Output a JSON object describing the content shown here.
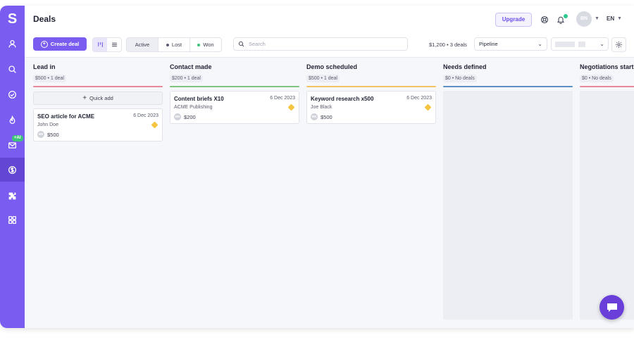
{
  "app": {
    "logo_letter": "S",
    "page_title": "Deals"
  },
  "sidebar": {
    "items": [
      {
        "name": "user-icon"
      },
      {
        "name": "search-icon"
      },
      {
        "name": "check-circle-icon"
      },
      {
        "name": "fire-icon"
      },
      {
        "name": "mail-icon",
        "badge": "+AI"
      },
      {
        "name": "dollar-icon",
        "active": true
      },
      {
        "name": "puzzle-icon"
      },
      {
        "name": "apps-icon"
      }
    ]
  },
  "header": {
    "upgrade_label": "Upgrade",
    "avatar_initials": "BN",
    "language": "EN"
  },
  "toolbar": {
    "create_label": "Create deal",
    "status_tabs": [
      {
        "label": "Active",
        "selected": true
      },
      {
        "label": "Lost",
        "dot_color": "#5a5e6e"
      },
      {
        "label": "Won",
        "dot_color": "#3ec37a"
      }
    ],
    "search_placeholder": "Search",
    "summary": "$1,200 • 3 deals",
    "pipeline_value": "Pipeline"
  },
  "columns": [
    {
      "title": "Lead in",
      "meta": "$500 • 1 deal",
      "color": "#e8889c",
      "quick_add": "Quick add",
      "cards": [
        {
          "title": "SEO article for ACME",
          "date": "6 Dec 2023",
          "contact": "John Doe",
          "avatar": "BN",
          "amount": "$500"
        }
      ]
    },
    {
      "title": "Contact made",
      "meta": "$200 • 1 deal",
      "color": "#7cc47a",
      "cards": [
        {
          "title": "Content briefs X10",
          "date": "6 Dec 2023",
          "contact": "ACME Publishing",
          "avatar": "BN",
          "amount": "$200"
        }
      ]
    },
    {
      "title": "Demo scheduled",
      "meta": "$500 • 1 deal",
      "color": "#f2c462",
      "cards": [
        {
          "title": "Keyword research x500",
          "date": "6 Dec 2023",
          "contact": "Joe Black",
          "avatar": "BN",
          "amount": "$500"
        }
      ]
    },
    {
      "title": "Needs defined",
      "meta": "$0 • No deals",
      "color": "#5b8fc4",
      "cards": []
    },
    {
      "title": "Negotiations start",
      "meta": "$0 • No deals",
      "color": "#e8889c",
      "cards": []
    }
  ],
  "colors": {
    "brand": "#7b5cf0",
    "chat": "#6a3fd9"
  }
}
